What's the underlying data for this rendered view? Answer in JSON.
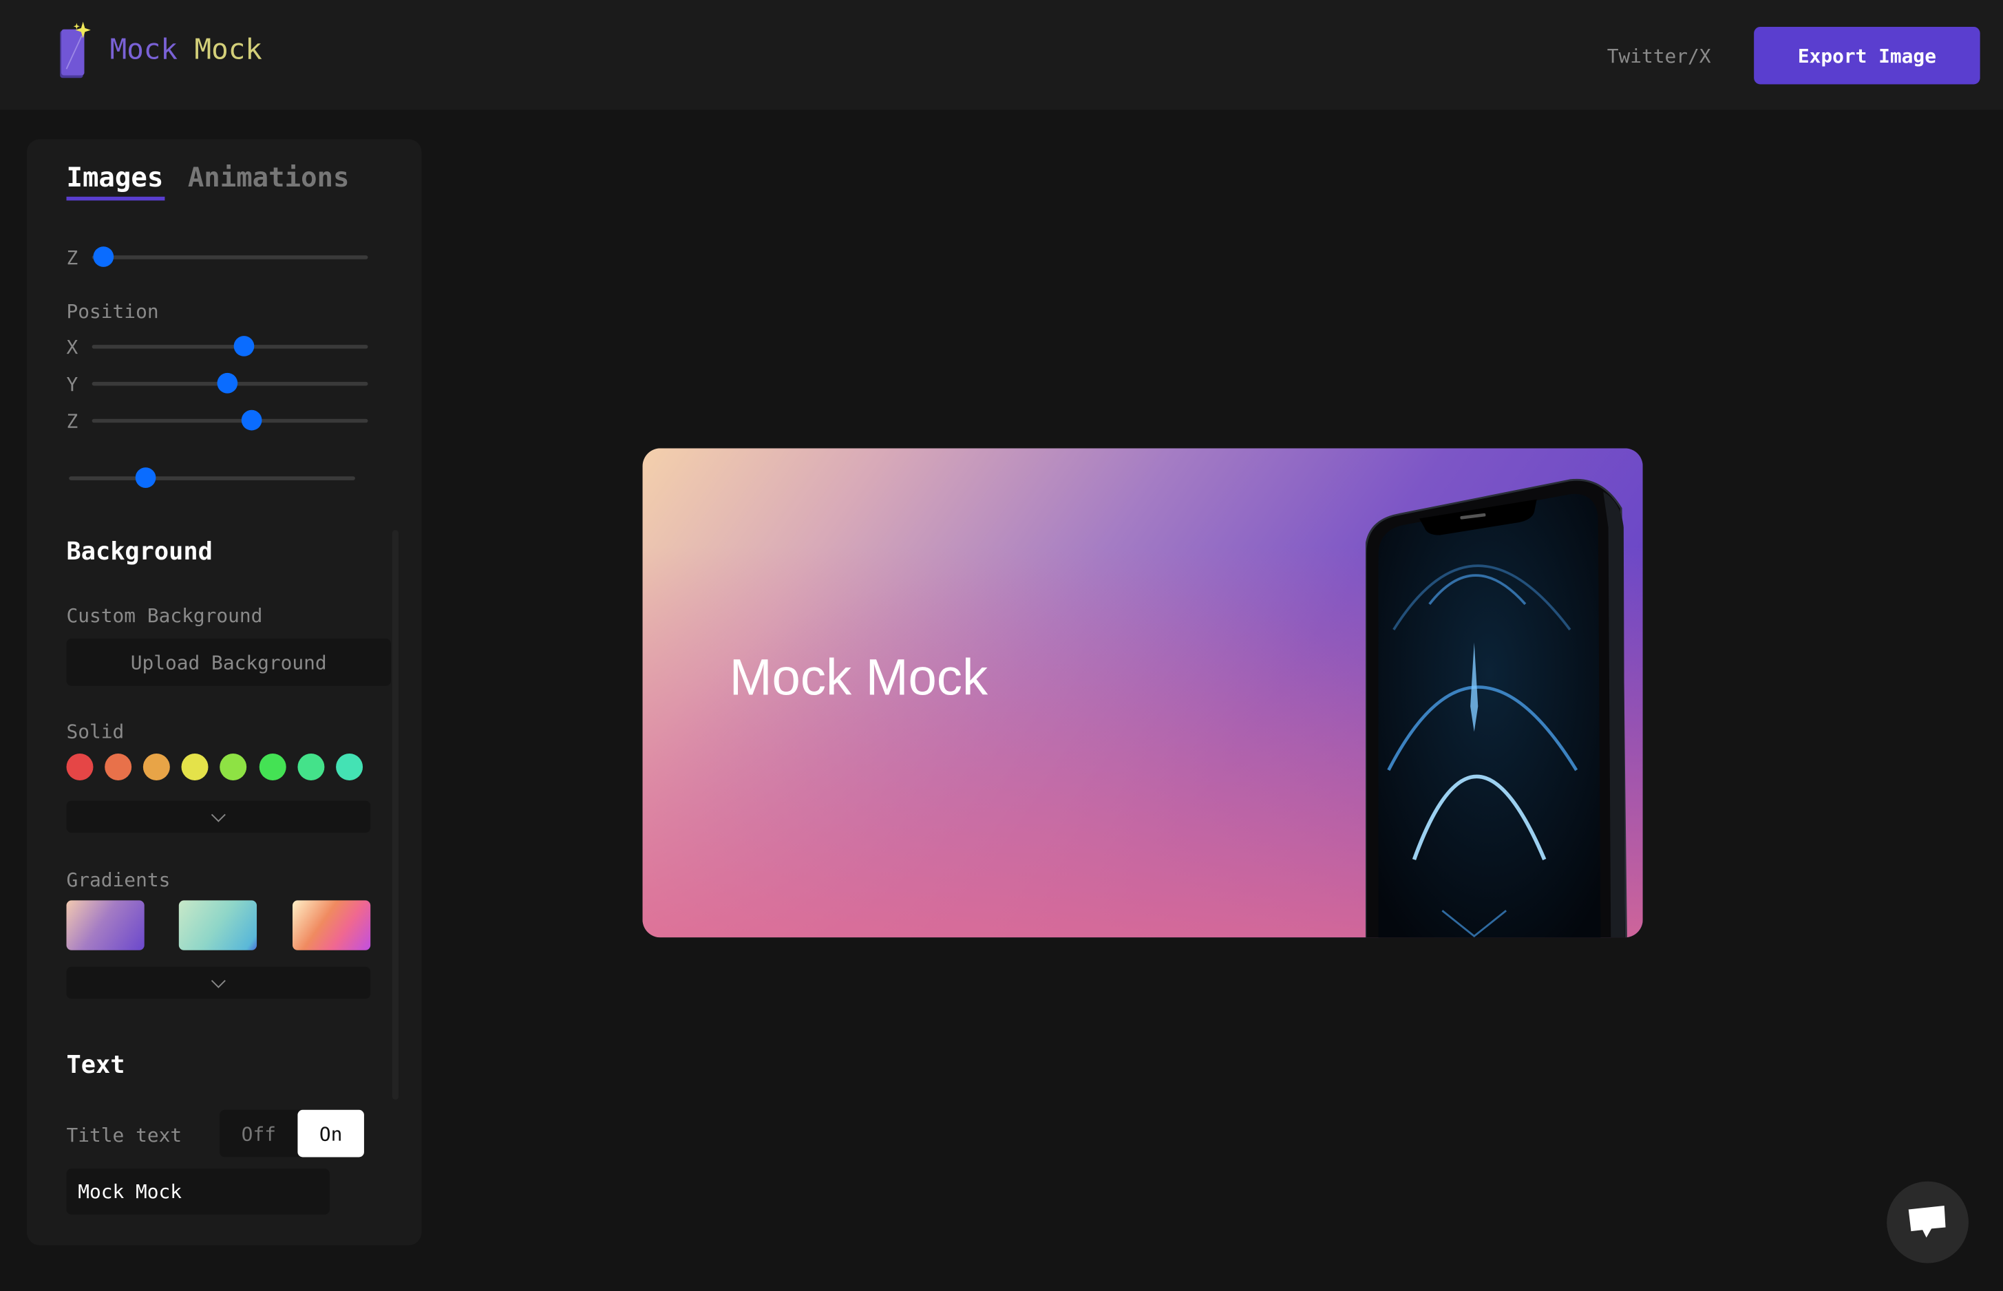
{
  "header": {
    "logo_word1": "Mock",
    "logo_word2": "Mock",
    "twitter_label": "Twitter/X",
    "export_label": "Export Image"
  },
  "sidebar": {
    "tabs": [
      {
        "label": "Images",
        "active": true
      },
      {
        "label": "Animations",
        "active": false
      }
    ],
    "zoom_slider": {
      "label": "Z",
      "value": 0.04
    },
    "position": {
      "label": "Position",
      "sliders": [
        {
          "label": "X",
          "value": 0.55
        },
        {
          "label": "Y",
          "value": 0.49
        },
        {
          "label": "Z",
          "value": 0.58
        }
      ]
    },
    "extra_slider": {
      "value": 0.27
    },
    "background": {
      "heading": "Background",
      "custom_label": "Custom Background",
      "upload_label": "Upload Background",
      "solid_label": "Solid",
      "solid_colors": [
        "#e54646",
        "#e8714a",
        "#e8a447",
        "#e4e24a",
        "#8ee244",
        "#44e254",
        "#44e28a",
        "#44e2b4"
      ],
      "gradients_label": "Gradients",
      "gradients": [
        "linear-gradient(125deg,#f2c9b0,#a47cc4 45%,#6b48cc 100%)",
        "linear-gradient(125deg,#c8e8c8,#8fd6c8 50%,#5ab8d8 90%,#4a70d8 100%)",
        "linear-gradient(125deg,#fff0c8,#f08a60 40%,#f06890 65%,#c050e0 100%)"
      ]
    },
    "text": {
      "heading": "Text",
      "title_label": "Title text",
      "toggle_off": "Off",
      "toggle_on": "On",
      "toggle_state": "On",
      "title_value": "Mock Mock"
    }
  },
  "canvas": {
    "title": "Mock Mock"
  },
  "colors": {
    "accent": "#5a3ecf",
    "slider": "#0a6cff"
  }
}
